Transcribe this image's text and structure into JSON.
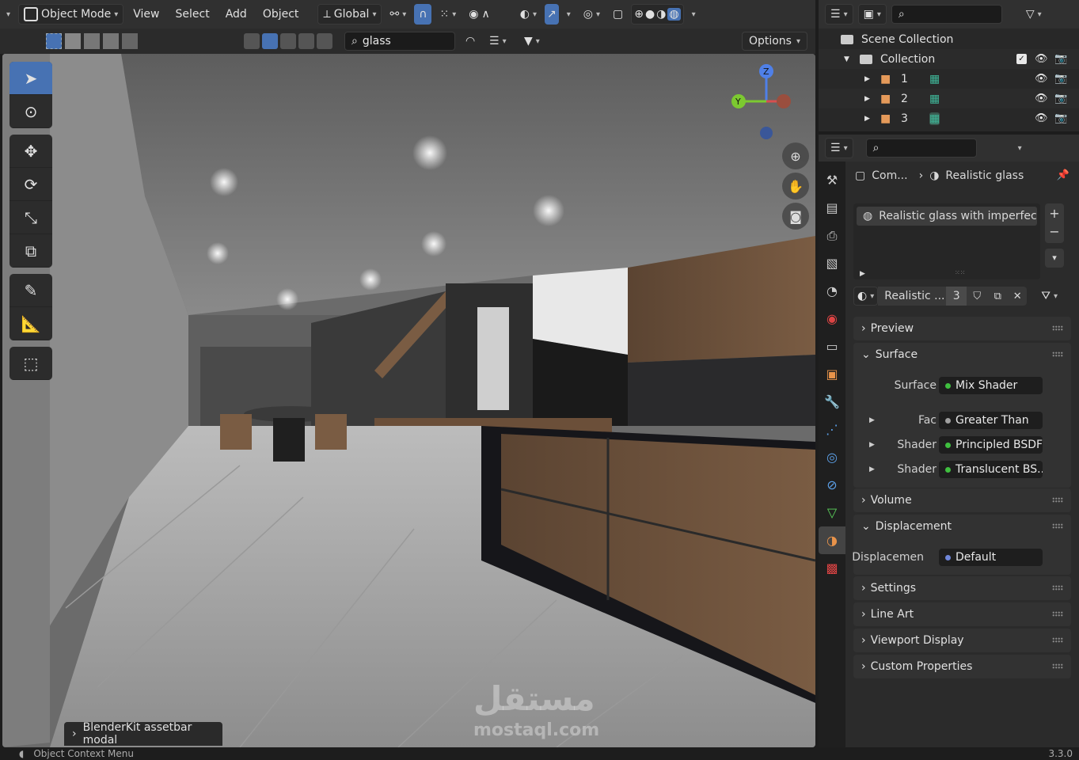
{
  "header": {
    "mode": "Object Mode",
    "menus": [
      "View",
      "Select",
      "Add",
      "Object"
    ],
    "transform_orientation": "Global",
    "search_text": "glass",
    "options_label": "Options"
  },
  "viewport": {
    "gizmo_z": "Z",
    "gizmo_y": "Y",
    "operator_panel": "BlenderKit assetbar modal",
    "watermark_arabic": "مستقل",
    "watermark_latin": "mostaql.com"
  },
  "outliner": {
    "scene_collection": "Scene Collection",
    "collection": "Collection",
    "items": [
      "1",
      "2",
      "3"
    ]
  },
  "properties": {
    "breadcrumb_object": "Com...",
    "breadcrumb_material": "Realistic glass",
    "slot_name": "Realistic glass with imperfec...",
    "material_name": "Realistic ...",
    "user_count": "3",
    "panels": {
      "preview": "Preview",
      "surface": "Surface",
      "volume": "Volume",
      "displacement": "Displacement",
      "settings": "Settings",
      "line_art": "Line Art",
      "viewport_display": "Viewport Display",
      "custom_properties": "Custom Properties"
    },
    "surface_rows": [
      {
        "label": "Surface",
        "value": "Mix Shader",
        "color": "#3fbf3f"
      },
      {
        "label": "Fac",
        "value": "Greater Than",
        "color": "#a0a0a0"
      },
      {
        "label": "Shader",
        "value": "Principled BSDF",
        "color": "#3fbf3f"
      },
      {
        "label": "Shader",
        "value": "Translucent BS...",
        "color": "#3fbf3f"
      }
    ],
    "displacement_row": {
      "label": "Displacemen",
      "value": "Default",
      "color": "#6f86d9"
    }
  },
  "status": {
    "context_menu": "Object Context Menu",
    "version": "3.3.0"
  },
  "colors": {
    "accent": "#4772b3",
    "header": "#303030",
    "panel": "#323232"
  }
}
